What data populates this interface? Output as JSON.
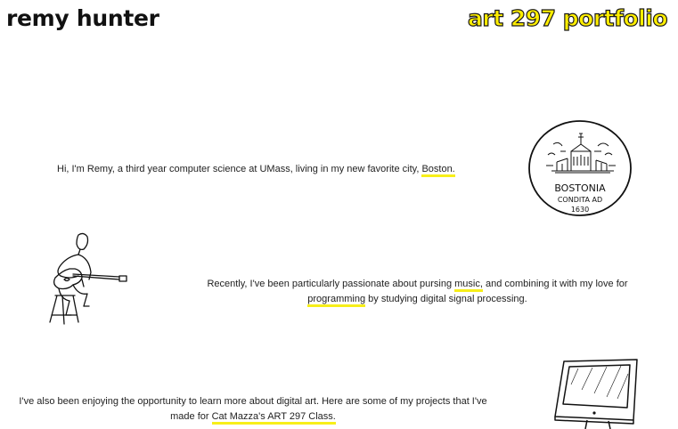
{
  "header": {
    "site_name": "remy hunter",
    "course_title": "art 297 portfolio"
  },
  "seal": {
    "line1": "BOSTONIA",
    "line2": "CONDITA AD",
    "line3": "1630"
  },
  "intro": {
    "text": "Hi, I'm Remy, a third year computer science at UMass, living in my new favorite city, ",
    "link": "Boston."
  },
  "music": {
    "text_before": "Recently, I've been particularly passionate about pursing ",
    "link_music": "music,",
    "text_middle": " and combining it with my love for ",
    "link_programming": "programming",
    "text_after": " by studying digital signal processing."
  },
  "art": {
    "text": "I've also been enjoying the opportunity to learn more about digital art. Here are some of my projects that I've made for ",
    "link": "Cat Mazza's ART 297 Class."
  },
  "colors": {
    "highlight": "#f7ef19",
    "title_fill": "#ffee00",
    "text": "#222222"
  },
  "icons": [
    "boston-seal-icon",
    "guitarist-icon",
    "monitor-icon"
  ]
}
